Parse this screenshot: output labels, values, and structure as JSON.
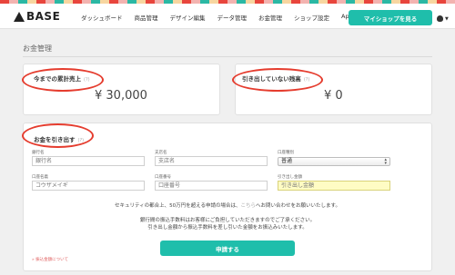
{
  "header": {
    "logo_text": "BASE",
    "nav": [
      "ダッシュボード",
      "商品管理",
      "デザイン編集",
      "データ管理",
      "お金管理",
      "ショップ設定",
      "Apps"
    ],
    "myshop_button": "マイショップを見る"
  },
  "page": {
    "title": "お金管理"
  },
  "sales_card": {
    "title": "今までの累計売上",
    "help": "(?)",
    "amount": "¥ 30,000"
  },
  "balance_card": {
    "title": "引き出していない残高",
    "help": "(?)",
    "amount": "¥ 0"
  },
  "withdraw": {
    "title": "お金を引き出す",
    "help": "(?)",
    "bank_name": {
      "label": "銀行名",
      "placeholder": "銀行名"
    },
    "branch_name": {
      "label": "支店名",
      "placeholder": "支店名"
    },
    "account_type": {
      "label": "口座種別",
      "value": "普通"
    },
    "account_holder": {
      "label": "口座名義",
      "placeholder": "コウザメイギ"
    },
    "account_number": {
      "label": "口座番号",
      "placeholder": "口座番号"
    },
    "amount": {
      "label": "引き出し金額",
      "placeholder": "引き出し金額"
    },
    "notice1_before": "セキュリティの都合上、50万円を超える申請の場合は、",
    "notice1_link": "こちら",
    "notice1_after": "へお問い合わせをお願いいたします。",
    "notice2": "銀行間の振込手数料はお客様にご負担していただきますのでご了承ください。",
    "notice3": "引き出し金額から振込手数料を差し引いた金額をお振込みいたします。",
    "apply_button": "申請する",
    "fee_link": "» 振込金額について"
  },
  "colors": {
    "accent": "#1fbeab",
    "annotation": "#e53c2e"
  }
}
